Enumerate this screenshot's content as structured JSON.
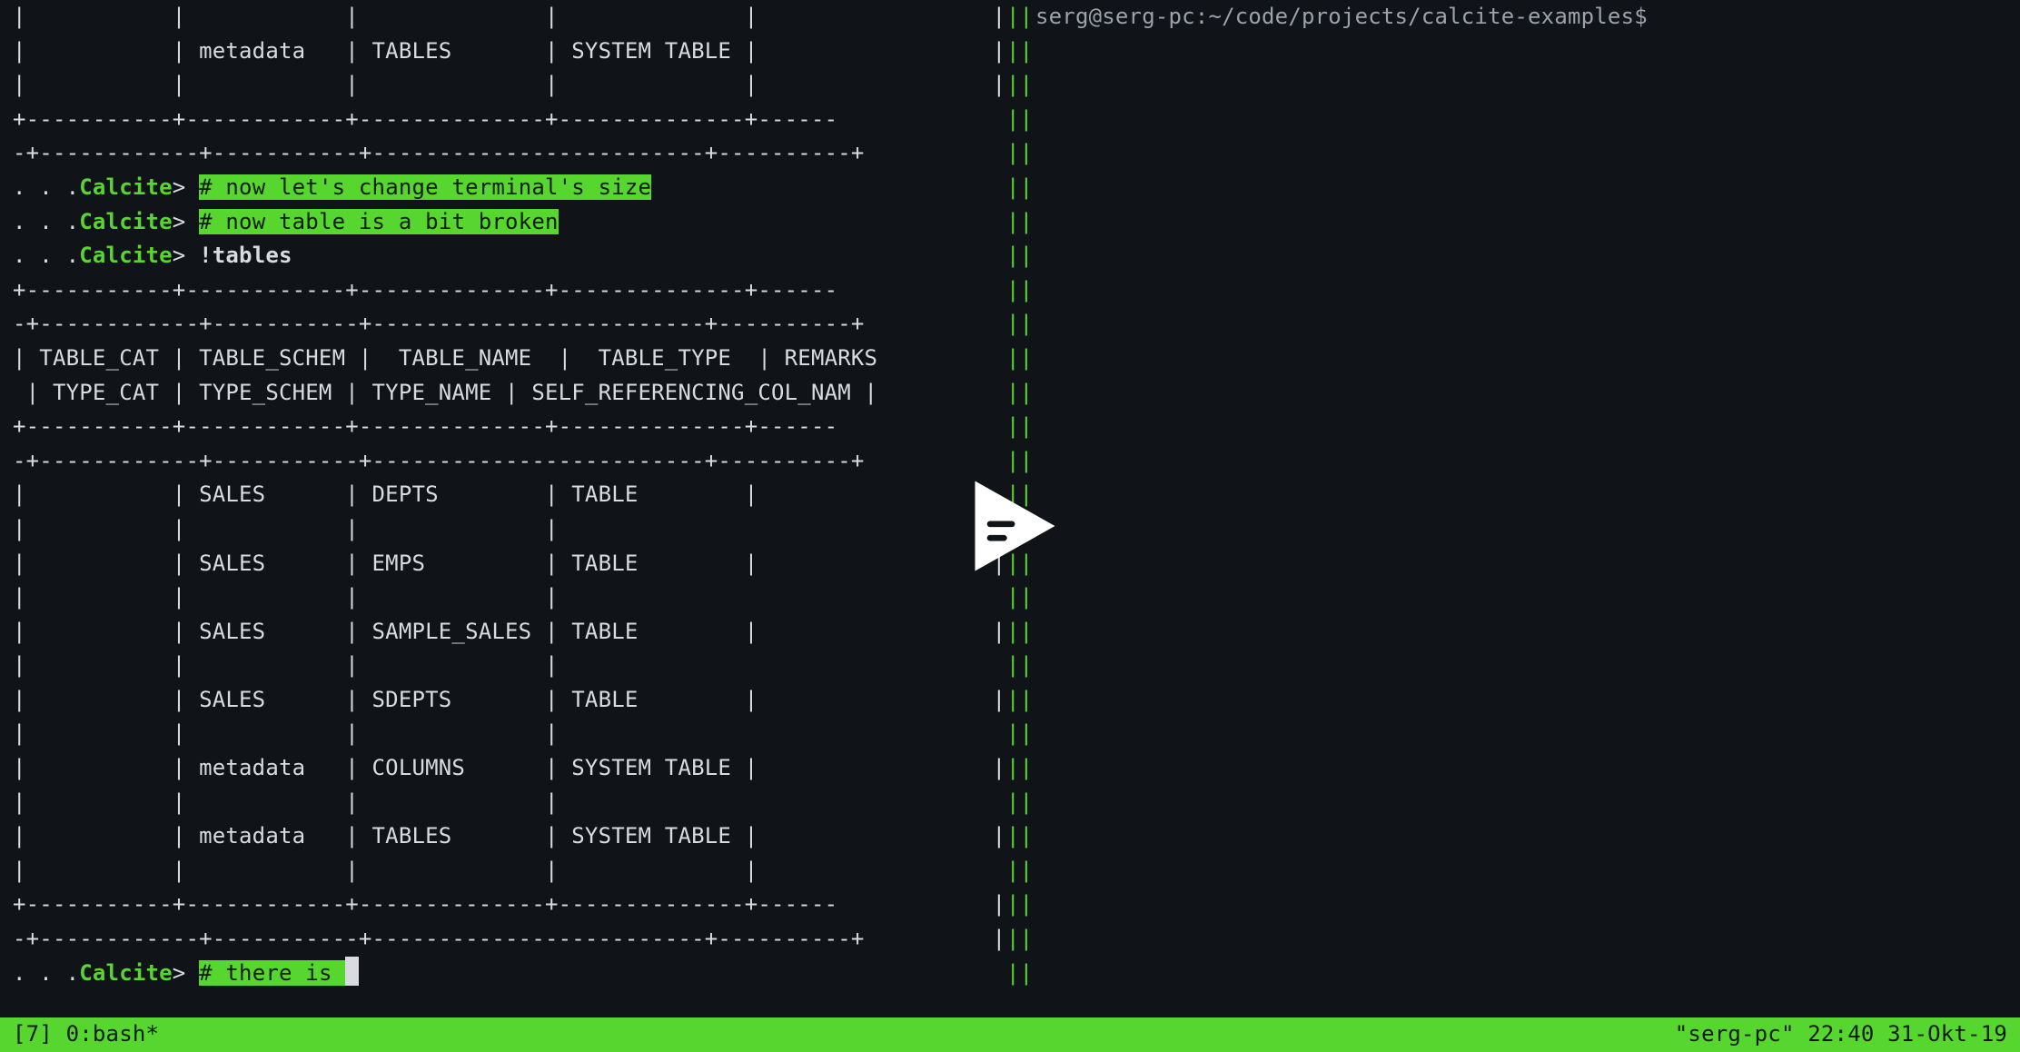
{
  "left": {
    "row_top1": "|           |            |              |              |",
    "row_top2": "|           | metadata   | TABLES       | SYSTEM TABLE |",
    "row_top3": "|           |            |              |              |",
    "sep_short": "+-----------+------------+--------------+--------------+------",
    "sep_long": "-+------------+-----------+-------------------------+----------+",
    "prompt_dots": ". . .",
    "prompt_name": "Calcite",
    "prompt_gt": "> ",
    "comment1": "# now let's change terminal's size",
    "comment2": "# now table is a bit broken",
    "cmd_tables": "!tables",
    "headers1": "| TABLE_CAT | TABLE_SCHEM |  TABLE_NAME  |  TABLE_TYPE  | REMARKS",
    "headers2": " | TYPE_CAT | TYPE_SCHEM | TYPE_NAME | SELF_REFERENCING_COL_NAM |",
    "row_sales1": "|           | SALES      | DEPTS        | TABLE        |",
    "row_blank": "|           |            |              |",
    "row_sales2": "|           | SALES      | EMPS         | TABLE        |",
    "row_sales3": "|           | SALES      | SAMPLE_SALES | TABLE        |",
    "row_sales4": "|           | SALES      | SDEPTS       | TABLE        |",
    "row_meta1": "|           | metadata   | COLUMNS      | SYSTEM TABLE |",
    "row_meta2": "|           | metadata   | TABLES       | SYSTEM TABLE |",
    "comment3": "# there is "
  },
  "right": {
    "prompt": "serg@serg-pc:~/code/projects/calcite-examples$"
  },
  "divider": "||",
  "divider_extra": " |",
  "statusbar": {
    "left": "[7] 0:bash*",
    "right": "\"serg-pc\" 22:40 31-Okt-19"
  }
}
